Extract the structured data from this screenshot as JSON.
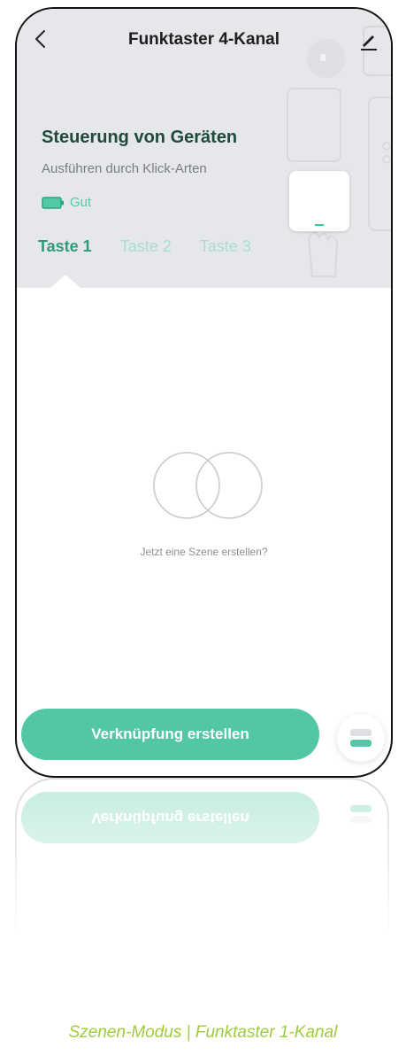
{
  "header": {
    "title": "Funktaster 4-Kanal",
    "back_icon": "chevron-left-icon",
    "edit_icon": "pencil-icon"
  },
  "hero": {
    "headline": "Steuerung von Geräten",
    "subline": "Ausführen durch Klick-Arten",
    "battery_label": "Gut",
    "battery_icon": "battery-icon"
  },
  "tabs": [
    {
      "label": "Taste 1",
      "active": true
    },
    {
      "label": "Taste 2",
      "active": false
    },
    {
      "label": "Taste 3",
      "active": false
    }
  ],
  "empty_state": {
    "icon": "overlapping-circles-icon",
    "text": "Jetzt eine Szene erstellen?"
  },
  "footer": {
    "cta_label": "Verknüpfung erstellen",
    "toggle_icon": "layout-toggle-icon"
  },
  "caption": "Szenen-Modus | Funktaster 1-Kanal",
  "colors": {
    "accent": "#52c7a5",
    "tab_active": "#2e9b7e",
    "tab_inactive": "#a9ddd0",
    "headline": "#1f4a3c",
    "hero_bg": "#e6e7ea",
    "caption": "#9fcc3b"
  }
}
